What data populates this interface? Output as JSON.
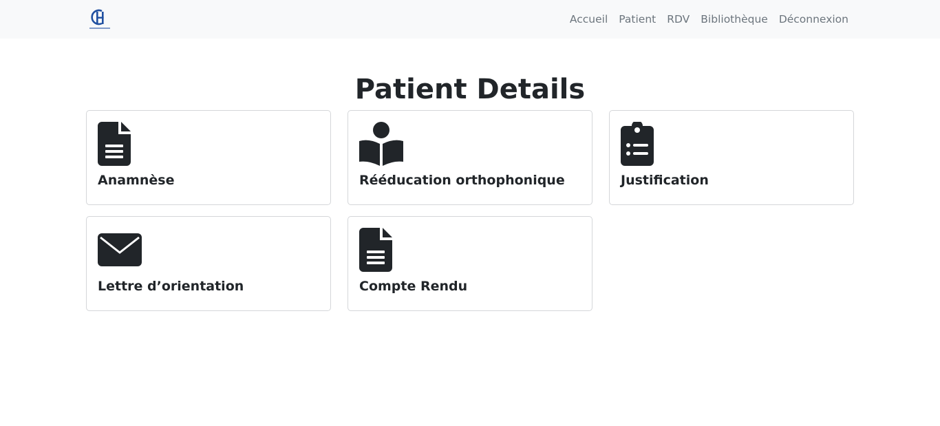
{
  "nav": {
    "logo_icon": "hospital-logo-icon",
    "links": [
      {
        "label": "Accueil"
      },
      {
        "label": "Patient"
      },
      {
        "label": "RDV"
      },
      {
        "label": "Bibliothèque"
      },
      {
        "label": "Déconnexion"
      }
    ]
  },
  "page": {
    "title": "Patient Details"
  },
  "cards": [
    {
      "label": "Anamnèse",
      "icon": "file-text-icon"
    },
    {
      "label": "Rééducation orthophonique",
      "icon": "book-reader-icon"
    },
    {
      "label": "Justification",
      "icon": "clipboard-list-icon"
    },
    {
      "label": "Lettre d’orientation",
      "icon": "envelope-icon"
    },
    {
      "label": "Compte Rendu",
      "icon": "file-text-icon"
    }
  ],
  "colors": {
    "navbar_bg": "#f8f9fa",
    "nav_link": "#6c757d",
    "text": "#212529",
    "card_border": "#d4d6d9",
    "logo_blue": "#1f4fa0"
  }
}
